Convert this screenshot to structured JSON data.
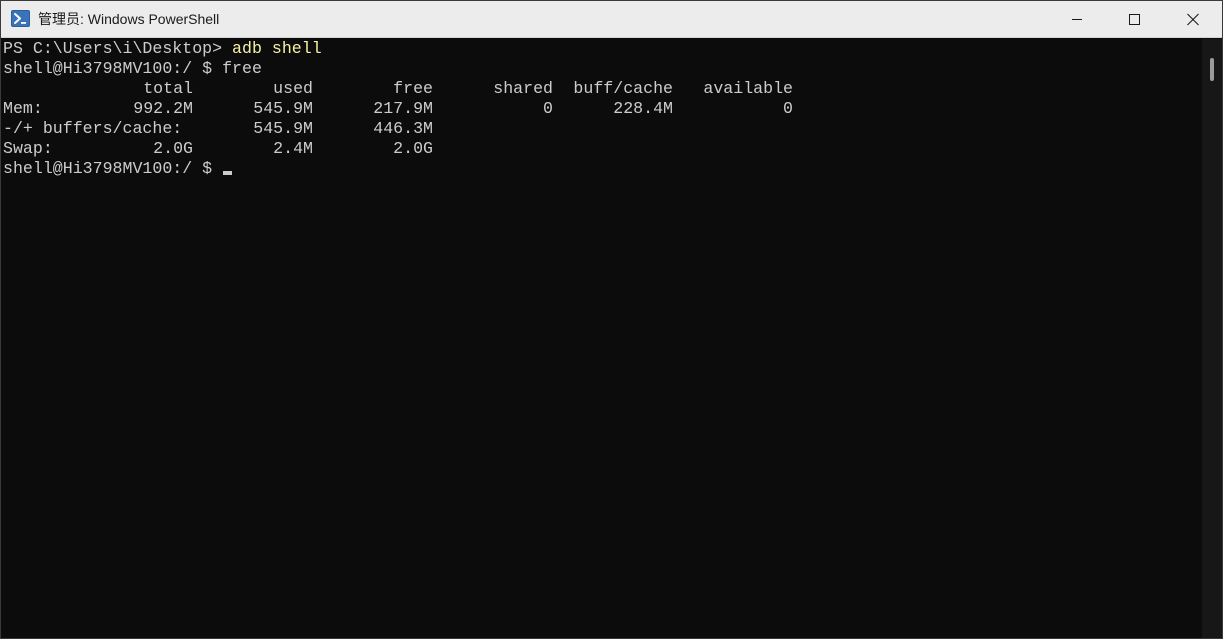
{
  "window": {
    "title": "管理员: Windows PowerShell",
    "app_icon": "powershell-icon",
    "controls": [
      "minimize-icon",
      "maximize-icon",
      "close-icon"
    ]
  },
  "terminal": {
    "prompt_ps": "PS C:\\Users\\i\\Desktop> ",
    "cmd_adb": "adb shell",
    "shell_prompt": "shell@Hi3798MV100:/ $ ",
    "cmd_free": "free",
    "table": {
      "headers": [
        "total",
        "used",
        "free",
        "shared",
        "buff/cache",
        "available"
      ],
      "mem": {
        "label": "Mem:",
        "values": [
          "992.2M",
          "545.9M",
          "217.9M",
          "0",
          "228.4M",
          "0"
        ]
      },
      "buffers": {
        "label": "-/+ buffers/cache:",
        "values": [
          "545.9M",
          "446.3M"
        ]
      },
      "swap": {
        "label": "Swap:",
        "values": [
          "2.0G",
          "2.4M",
          "2.0G"
        ]
      }
    },
    "final_prompt": "shell@Hi3798MV100:/ $ "
  },
  "colors": {
    "background": "#0c0c0c",
    "foreground": "#cccccc",
    "command": "#f9f1a5",
    "titlebar": "#ececec",
    "icon_blue": "#2d5f9e"
  }
}
